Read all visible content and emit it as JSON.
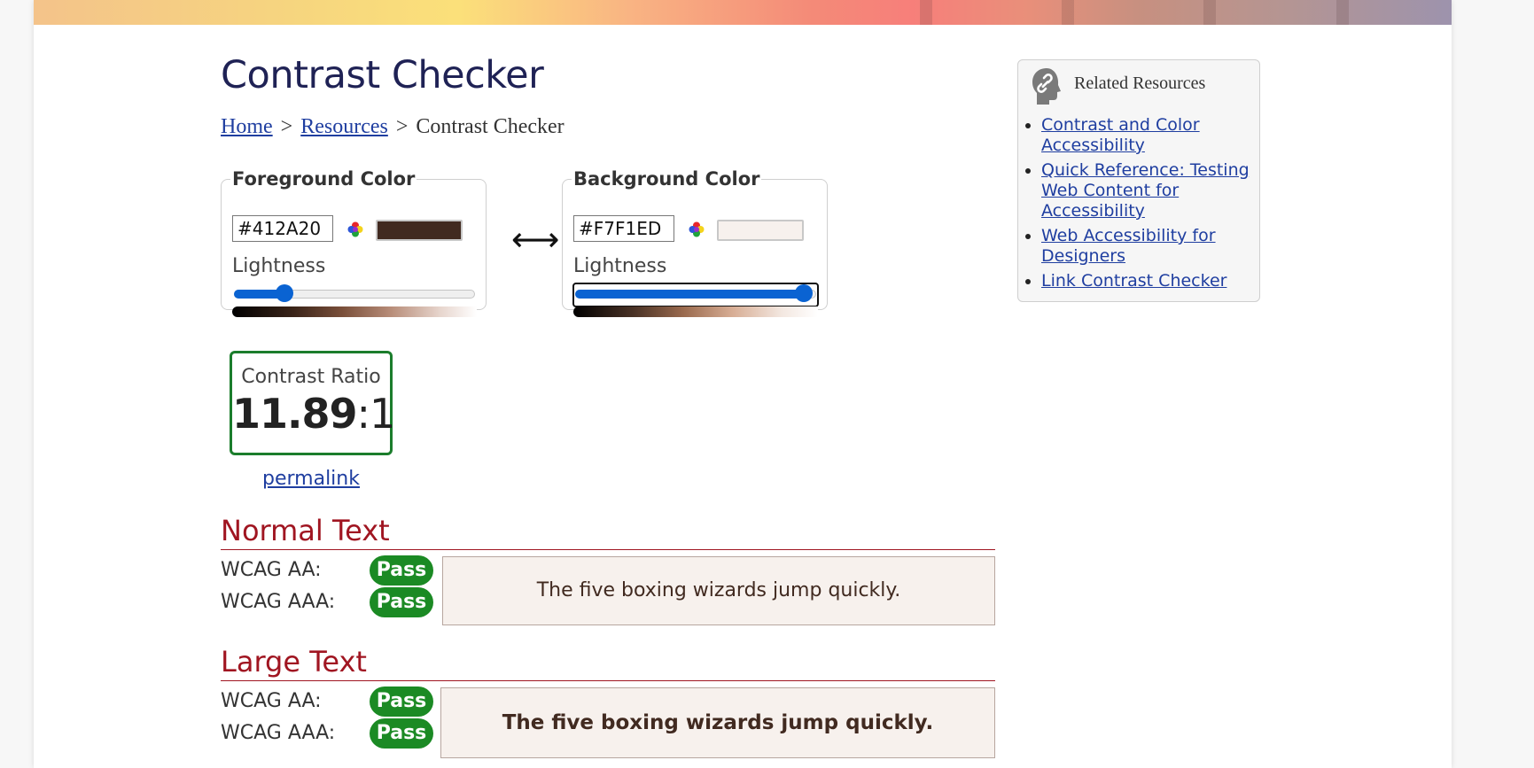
{
  "page": {
    "title": "Contrast Checker"
  },
  "breadcrumb": {
    "home": "Home",
    "sep1": ">",
    "resources": "Resources",
    "sep2": ">",
    "current": "Contrast Checker"
  },
  "foreground": {
    "legend": "Foreground Color",
    "hex": "#412A20",
    "color": "#412A20",
    "lightness_label": "Lightness",
    "lightness_value": 0.21
  },
  "background": {
    "legend": "Background Color",
    "hex": "#F7F1ED",
    "color": "#F7F1ED",
    "lightness_label": "Lightness",
    "lightness_value": 0.95
  },
  "swap": {
    "glyph": "⟷"
  },
  "contrast": {
    "label": "Contrast Ratio",
    "value": "11.89",
    "suffix": ":1"
  },
  "permalink": "permalink",
  "normal_text": {
    "heading": "Normal Text",
    "aa_label": "WCAG AA:",
    "aa_result": "Pass",
    "aaa_label": "WCAG AAA:",
    "aaa_result": "Pass",
    "sample": "The five boxing wizards jump quickly."
  },
  "large_text": {
    "heading": "Large Text",
    "aa_label": "WCAG AA:",
    "aa_result": "Pass",
    "aaa_label": "WCAG AAA:",
    "aaa_result": "Pass",
    "sample": "The five boxing wizards jump quickly."
  },
  "related": {
    "title": "Related Resources",
    "items": [
      {
        "label": "Contrast and Color Accessibility"
      },
      {
        "label": "Quick Reference: Testing Web Content for Accessibility"
      },
      {
        "label": "Web Accessibility for Designers"
      },
      {
        "label": "Link Contrast Checker"
      }
    ]
  },
  "colors": {
    "pass": "#1b8a24",
    "heading": "#a01521",
    "link": "#1f3ea0",
    "accent": "#0a63d2",
    "title": "#1f2255"
  }
}
